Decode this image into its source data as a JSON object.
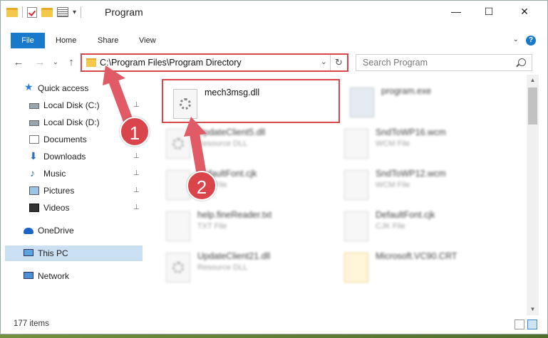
{
  "window": {
    "title": "Program",
    "quick_access_toolbar": [
      "folder-icon",
      "properties-check-icon",
      "new-folder-icon",
      "properties-icon",
      "dropdown-icon"
    ],
    "controls": {
      "minimize": "—",
      "maximize": "☐",
      "close": "✕"
    }
  },
  "ribbon": {
    "tabs": [
      {
        "label": "File",
        "active": true
      },
      {
        "label": "Home"
      },
      {
        "label": "Share"
      },
      {
        "label": "View"
      }
    ],
    "expand_glyph": "⌄",
    "help_glyph": "?"
  },
  "navigation": {
    "back_glyph": "←",
    "forward_glyph": "→",
    "dropdown_glyph": "⌄",
    "up_glyph": "↑",
    "address": "C:\\Program Files\\Program Directory",
    "address_dropdown_glyph": "⌄",
    "refresh_glyph": "↻",
    "search_placeholder": "Search Program"
  },
  "sidebar": {
    "quick_access": {
      "label": "Quick access",
      "icon": "star-icon"
    },
    "items": [
      {
        "label": "Local Disk (C:)",
        "icon": "drive-icon",
        "pinned": true
      },
      {
        "label": "Local Disk (D:)",
        "icon": "drive-icon",
        "pinned": false
      },
      {
        "label": "Documents",
        "icon": "documents-icon",
        "pinned": true
      },
      {
        "label": "Downloads",
        "icon": "downloads-icon",
        "pinned": true
      },
      {
        "label": "Music",
        "icon": "music-icon",
        "pinned": true
      },
      {
        "label": "Pictures",
        "icon": "pictures-icon",
        "pinned": true
      },
      {
        "label": "Videos",
        "icon": "videos-icon",
        "pinned": true
      }
    ],
    "onedrive": "OneDrive",
    "this_pc": "This PC",
    "network": "Network",
    "pin_glyph": "📌"
  },
  "files": [
    {
      "name": "mech3msg.dll",
      "type": "",
      "icon": "dll-file-icon",
      "highlighted": true
    },
    {
      "name": "program.exe",
      "type": "",
      "icon": "exe-file-icon"
    },
    {
      "name": "UpdateClient5.dll",
      "type": "Resource DLL",
      "icon": "dll-file-icon"
    },
    {
      "name": "SndToWP16.wcm",
      "type": "WCM File",
      "icon": "blank-file-icon"
    },
    {
      "name": "DefaultFont.cjk",
      "type": "CJK File",
      "icon": "blank-file-icon"
    },
    {
      "name": "SndToWP12.wcm",
      "type": "WCM File",
      "icon": "blank-file-icon"
    },
    {
      "name": "help.fineReader.txt",
      "type": "TXT File",
      "icon": "blank-file-icon"
    },
    {
      "name": "DefaultFont.cjk",
      "type": "CJK File",
      "icon": "blank-file-icon"
    },
    {
      "name": "UpdateClient21.dll",
      "type": "Resource DLL",
      "icon": "dll-file-icon"
    },
    {
      "name": "Microsoft.VC90.CRT",
      "type": "",
      "icon": "folder-file-icon"
    }
  ],
  "status": {
    "item_count": "177 items"
  },
  "annotations": [
    {
      "number": "1",
      "color": "#d9454b"
    },
    {
      "number": "2",
      "color": "#d9454b"
    }
  ],
  "colors": {
    "accent": "#1979ca",
    "highlight": "#d9454b",
    "selection": "#cce0f4"
  }
}
